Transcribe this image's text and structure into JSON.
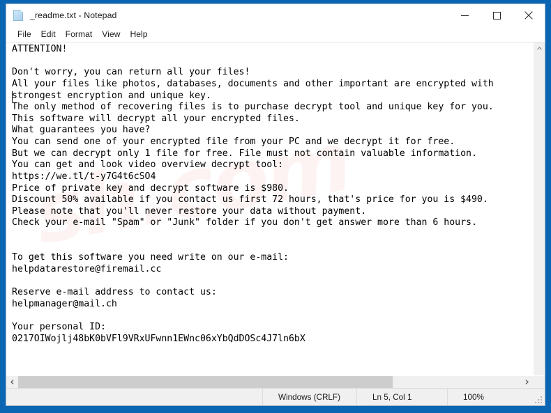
{
  "window": {
    "title": "_readme.txt - Notepad",
    "icon": "text-document-icon",
    "controls": {
      "minimize": "minimize-icon",
      "maximize": "maximize-icon",
      "close": "close-icon"
    }
  },
  "menu": {
    "items": [
      {
        "label": "File"
      },
      {
        "label": "Edit"
      },
      {
        "label": "Format"
      },
      {
        "label": "View"
      },
      {
        "label": "Help"
      }
    ]
  },
  "editor": {
    "watermark": "sh.com",
    "content": "ATTENTION!\n\nDon't worry, you can return all your files!\nAll your files like photos, databases, documents and other important are encrypted with\nstrongest encryption and unique key.\nThe only method of recovering files is to purchase decrypt tool and unique key for you.\nThis software will decrypt all your encrypted files.\nWhat guarantees you have?\nYou can send one of your encrypted file from your PC and we decrypt it for free.\nBut we can decrypt only 1 file for free. File must not contain valuable information.\nYou can get and look video overview decrypt tool:\nhttps://we.tl/t-y7G4t6cSO4\nPrice of private key and decrypt software is $980.\nDiscount 50% available if you contact us first 72 hours, that's price for you is $490.\nPlease note that you'll never restore your data without payment.\nCheck your e-mail \"Spam\" or \"Junk\" folder if you don't get answer more than 6 hours.\n\n\nTo get this software you need write on our e-mail:\nhelpdatarestore@firemail.cc\n\nReserve e-mail address to contact us:\nhelpmanager@mail.ch\n\nYour personal ID:\n0217OIWojlj48bK0bVFl9VRxUFwnn1EWnc06xYbQdDOSc4J7ln6bX",
    "lines": [
      "ATTENTION!",
      "",
      "Don't worry, you can return all your files!",
      "All your files like photos, databases, documents and other important are encrypted with",
      "strongest encryption and unique key.",
      "The only method of recovering files is to purchase decrypt tool and unique key for you.",
      "This software will decrypt all your encrypted files.",
      "What guarantees you have?",
      "You can send one of your encrypted file from your PC and we decrypt it for free.",
      "But we can decrypt only 1 file for free. File must not contain valuable information.",
      "You can get and look video overview decrypt tool:",
      "https://we.tl/t-y7G4t6cSO4",
      "Price of private key and decrypt software is $980.",
      "Discount 50% available if you contact us first 72 hours, that's price for you is $490.",
      "Please note that you'll never restore your data without payment.",
      "Check your e-mail \"Spam\" or \"Junk\" folder if you don't get answer more than 6 hours.",
      "",
      "",
      "To get this software you need write on our e-mail:",
      "helpdatarestore@firemail.cc",
      "",
      "Reserve e-mail address to contact us:",
      "helpmanager@mail.ch",
      "",
      "Your personal ID:",
      "0217OIWojlj48bK0bVFl9VRxUFwnn1EWnc06xYbQdDOSc4J7ln6bX"
    ],
    "details": {
      "ransom_price": "$980",
      "discount_price": "$490",
      "discount_percent": "50%",
      "discount_window_hours": "72",
      "answer_window_hours": "6",
      "free_files": "1",
      "video_url": "https://we.tl/t-y7G4t6cSO4",
      "primary_email": "helpdatarestore@firemail.cc",
      "reserve_email": "helpmanager@mail.ch",
      "personal_id": "0217OIWojlj48bK0bVFl9VRxUFwnn1EWnc06xYbQdDOSc4J7ln6bX"
    }
  },
  "scrollbars": {
    "vertical_up": "chevron-up-icon",
    "vertical_down": "chevron-down-icon",
    "horizontal_left": "chevron-left-icon",
    "horizontal_right": "chevron-right-icon"
  },
  "status_bar": {
    "encoding": "Windows (CRLF)",
    "position": "Ln 5, Col 1",
    "zoom": "100%"
  },
  "colors": {
    "desktop_blue": "#0a65b2",
    "window_bg": "#ffffff",
    "status_bg": "#f0f0f0",
    "scroll_thumb": "#cdcdcd",
    "text": "#000000"
  }
}
